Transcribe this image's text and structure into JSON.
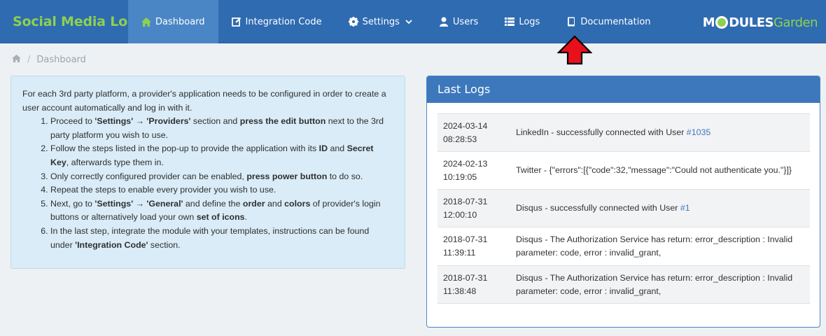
{
  "brand": "Social Media Login",
  "nav": [
    {
      "label": "Dashboard",
      "icon": "home-icon"
    },
    {
      "label": "Integration Code",
      "icon": "edit-icon"
    },
    {
      "label": "Settings",
      "icon": "gear-icon"
    },
    {
      "label": "Users",
      "icon": "user-icon"
    },
    {
      "label": "Logs",
      "icon": "list-icon"
    },
    {
      "label": "Documentation",
      "icon": "book-icon"
    }
  ],
  "logo": {
    "part1": "M",
    "part2": "DULES",
    "part3": "Garden"
  },
  "breadcrumb": {
    "current": "Dashboard",
    "separator": "/"
  },
  "info": {
    "intro": "For each 3rd party platform, a provider's application needs to be configured in order to create a user account automatically and log in with it.",
    "steps": [
      {
        "a": "Proceed to ",
        "b": "'Settings' → 'Providers'",
        "c": " section and ",
        "d": "press the edit button",
        "e": " next to the 3rd party platform you wish to use."
      },
      {
        "a": "Follow the steps listed in the pop-up to provide the application with its ",
        "b": "ID",
        "c": " and ",
        "d": "Secret Key",
        "e": ", afterwards type them in."
      },
      {
        "a": "Only correctly configured provider can be enabled, ",
        "b": "press power button",
        "c": " to do so.",
        "d": "",
        "e": ""
      },
      {
        "a": "Repeat the steps to enable every provider you wish to use.",
        "b": "",
        "c": "",
        "d": "",
        "e": ""
      },
      {
        "a": "Next, go to ",
        "b": "'Settings' → 'General'",
        "c": " and define the ",
        "d": "order",
        "e": " and ",
        "f": "colors",
        "g": " of provider's login buttons or alternatively load your own ",
        "h": "set of icons",
        "i": "."
      },
      {
        "a": "In the last step, integrate the module with your templates, instructions can be found under ",
        "b": "'Integration Code'",
        "c": " section.",
        "d": "",
        "e": ""
      }
    ]
  },
  "logs": {
    "title": "Last Logs",
    "rows": [
      {
        "date": "2024-03-14",
        "time": "08:28:53",
        "msg": "LinkedIn - successfully connected with User ",
        "link": "#1035"
      },
      {
        "date": "2024-02-13",
        "time": "10:19:05",
        "msg": "Twitter - {\"errors\":[{\"code\":32,\"message\":\"Could not authenticate you.\"}]}",
        "link": ""
      },
      {
        "date": "2018-07-31",
        "time": "12:00:10",
        "msg": "Disqus - successfully connected with User ",
        "link": "#1"
      },
      {
        "date": "2018-07-31",
        "time": "11:39:11",
        "msg": "Disqus - The Authorization Service has return: error_description : Invalid parameter: code, error : invalid_grant,",
        "link": ""
      },
      {
        "date": "2018-07-31",
        "time": "11:38:48",
        "msg": "Disqus - The Authorization Service has return: error_description : Invalid parameter: code, error : invalid_grant,",
        "link": ""
      }
    ]
  },
  "colors": {
    "nav_bg": "#2f6bb1",
    "nav_active": "#4a86c5",
    "brand": "#8dd14f",
    "panel_head": "#3c78bb",
    "info_bg": "#d9ecf7",
    "arrow": "#e8101a"
  }
}
